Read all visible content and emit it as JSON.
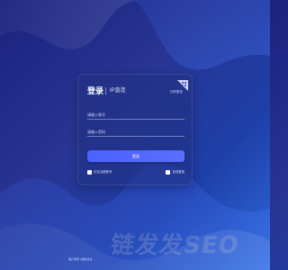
{
  "login": {
    "title": "登录",
    "subtitle": "IP直连",
    "qr_hint": "扫码登录",
    "username_placeholder": "请输入账号",
    "password_placeholder": "请输入密码",
    "submit_label": "登录",
    "remember_label": "记住当前账号",
    "auto_login_label": "自动登录"
  },
  "footer": {
    "text": "用户登录 | 服务协议"
  },
  "watermark": {
    "text": "链发发SEO"
  },
  "colors": {
    "background_start": "#1a237e",
    "background_end": "#2f6bdc",
    "button": "#4b61ff",
    "card": "#233380"
  },
  "icons": {
    "qr_corner": "qr-code-icon",
    "remember_checkbox": "checkbox-icon",
    "auto_login_checkbox": "checkbox-icon"
  }
}
